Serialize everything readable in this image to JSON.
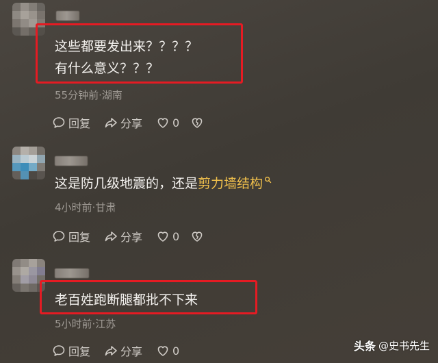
{
  "comments": [
    {
      "lines": [
        "这些都要发出来？？？？",
        "有什么意义？？？"
      ],
      "meta": "55分钟前·湖南",
      "reply_label": "回复",
      "share_label": "分享",
      "like_count": "0"
    },
    {
      "text_plain": "这是防几级地震的，还是",
      "text_link": "剪力墙结构",
      "meta": "4小时前·甘肃",
      "reply_label": "回复",
      "share_label": "分享",
      "like_count": "0"
    },
    {
      "text_plain": "老百姓跑断腿都批不下来",
      "meta": "5小时前·江苏",
      "reply_label": "回复",
      "share_label": "分享",
      "like_count": "0"
    }
  ],
  "watermark": {
    "logo": "头条",
    "handle": "@史书先生"
  },
  "colors": {
    "highlight": "#f2c14c",
    "annotation_box": "#e51b23"
  }
}
